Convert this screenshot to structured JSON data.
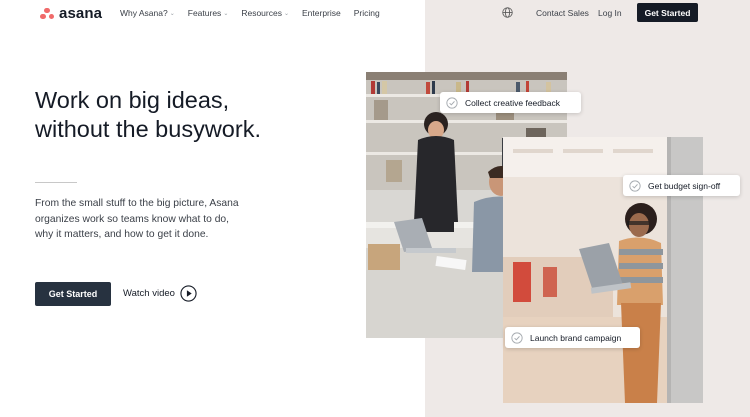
{
  "nav": {
    "brand": "asana",
    "links": [
      {
        "label": "Why Asana?",
        "caret": "⌄"
      },
      {
        "label": "Features",
        "caret": "⌄"
      },
      {
        "label": "Resources",
        "caret": "⌄"
      },
      {
        "label": "Enterprise",
        "caret": ""
      },
      {
        "label": "Pricing",
        "caret": ""
      }
    ],
    "contact": "Contact Sales",
    "login": "Log In",
    "cta": "Get Started"
  },
  "hero": {
    "headline_line1": "Work on big ideas,",
    "headline_line2": "without the busywork.",
    "subtext": "From the small stuff to the big picture, Asana organizes work so teams know what to do, why it matters, and how to get it done.",
    "cta": "Get Started",
    "watch": "Watch video"
  },
  "cards": {
    "card1": "Collect creative feedback",
    "card2": "Get budget sign-off",
    "card3": "Launch brand campaign"
  },
  "colors": {
    "brand": "#f06a6a",
    "dark": "#151b26",
    "button": "#273240",
    "panel": "#eee9e7"
  },
  "icons": [
    "asana-logo-icon",
    "globe-icon",
    "play-icon",
    "check-circle-icon"
  ]
}
